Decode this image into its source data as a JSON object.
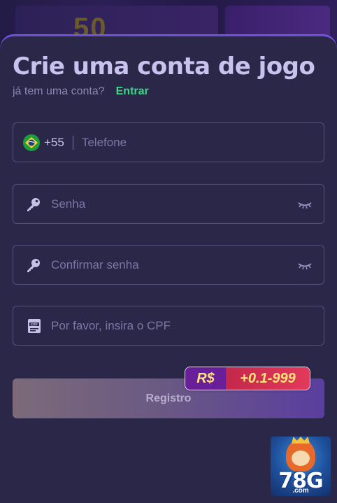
{
  "banner": {
    "text": "50"
  },
  "form": {
    "title": "Crie uma conta de jogo",
    "subtitle": "já tem uma conta?",
    "login_link": "Entrar",
    "phone": {
      "country_flag": "brazil-flag-icon",
      "dial_code": "+55",
      "placeholder": "Telefone"
    },
    "password": {
      "placeholder": "Senha"
    },
    "confirm_password": {
      "placeholder": "Confirmar senha"
    },
    "cpf": {
      "placeholder": "Por favor, insira o CPF"
    },
    "submit_label": "Registro"
  },
  "bonus": {
    "currency": "R$",
    "amount": "+0.1-999"
  },
  "logo": {
    "text": "78G",
    "sub": ".com"
  },
  "colors": {
    "background": "#2b2748",
    "accent_border": "#6a4fd6",
    "login_link": "#3ed68a",
    "title": "#c9c2ee"
  }
}
